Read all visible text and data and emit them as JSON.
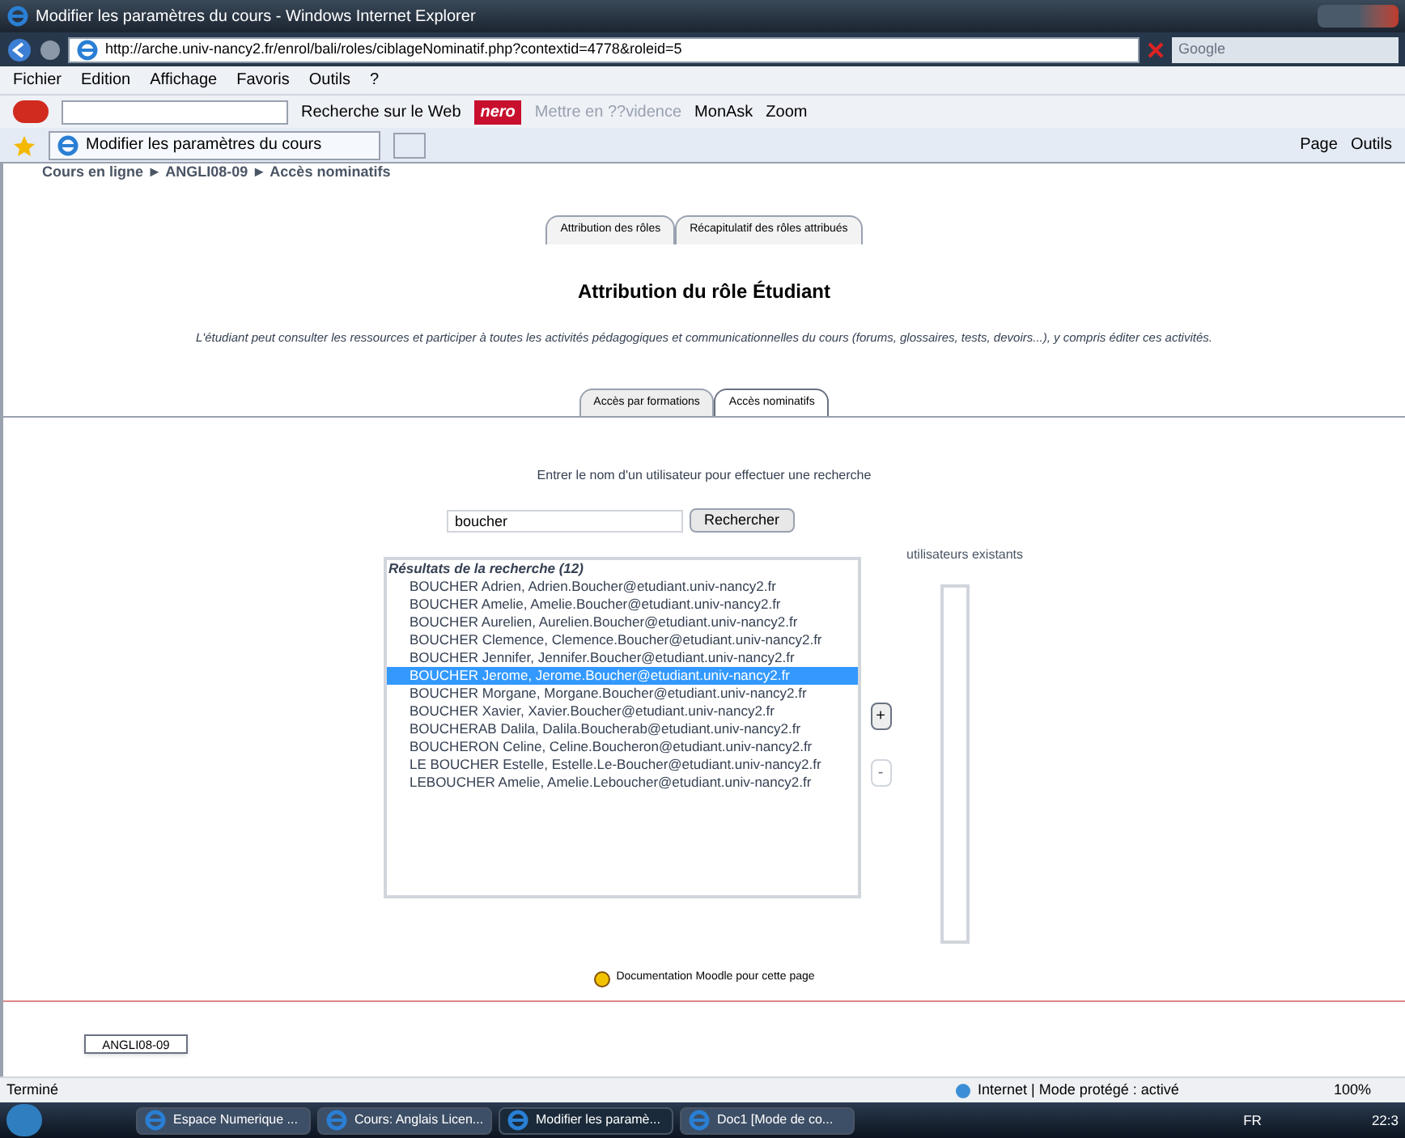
{
  "window": {
    "title": "Modifier les paramètres du cours - Windows Internet Explorer"
  },
  "address_bar": {
    "url": "http://arche.univ-nancy2.fr/enrol/bali/roles/ciblageNominatif.php?contextid=4778&roleid=5",
    "search_placeholder": "Google"
  },
  "menu": [
    "Fichier",
    "Edition",
    "Affichage",
    "Favoris",
    "Outils",
    "?"
  ],
  "toolbar": {
    "search_label": "Recherche sur le Web",
    "brand": "nero",
    "items": [
      {
        "label": "Mettre en ??vidence",
        "disabled": true
      },
      {
        "label": "MonAsk",
        "disabled": false
      },
      {
        "label": "Zoom",
        "disabled": false
      }
    ]
  },
  "browser_tab": {
    "title": "Modifier les paramètres du cours"
  },
  "command_bar": [
    "Page",
    "Outils"
  ],
  "breadcrumb": "Cours en ligne ► ANGLI08-09 ► Accès nominatifs",
  "tabs": [
    {
      "label": "Attribution des rôles",
      "selected": false
    },
    {
      "label": "Récapitulatif des rôles attribués",
      "selected": false
    }
  ],
  "heading": "Attribution du rôle Étudiant",
  "description": "L'étudiant peut consulter les ressources et participer à toutes les activités pédagogiques et communicationnelles du cours (forums, glossaires, tests, devoirs...), y compris éditer ces activités.",
  "subtabs": [
    {
      "label": "Accès par formations",
      "selected": false
    },
    {
      "label": "Accès nominatifs",
      "selected": true
    }
  ],
  "search": {
    "prompt": "Entrer le nom d'un utilisateur pour effectuer une recherche",
    "value": "boucher",
    "button": "Rechercher"
  },
  "results": {
    "header": "Résultats de la recherche (12)",
    "items": [
      {
        "label": "BOUCHER Adrien, Adrien.Boucher@etudiant.univ-nancy2.fr",
        "selected": false
      },
      {
        "label": "BOUCHER Amelie, Amelie.Boucher@etudiant.univ-nancy2.fr",
        "selected": false
      },
      {
        "label": "BOUCHER Aurelien, Aurelien.Boucher@etudiant.univ-nancy2.fr",
        "selected": false
      },
      {
        "label": "BOUCHER Clemence, Clemence.Boucher@etudiant.univ-nancy2.fr",
        "selected": false
      },
      {
        "label": "BOUCHER Jennifer, Jennifer.Boucher@etudiant.univ-nancy2.fr",
        "selected": false
      },
      {
        "label": "BOUCHER Jerome, Jerome.Boucher@etudiant.univ-nancy2.fr",
        "selected": true
      },
      {
        "label": "BOUCHER Morgane, Morgane.Boucher@etudiant.univ-nancy2.fr",
        "selected": false
      },
      {
        "label": "BOUCHER Xavier, Xavier.Boucher@etudiant.univ-nancy2.fr",
        "selected": false
      },
      {
        "label": "BOUCHERAB Dalila, Dalila.Boucherab@etudiant.univ-nancy2.fr",
        "selected": false
      },
      {
        "label": "BOUCHERON Celine, Celine.Boucheron@etudiant.univ-nancy2.fr",
        "selected": false
      },
      {
        "label": "LE BOUCHER Estelle, Estelle.Le-Boucher@etudiant.univ-nancy2.fr",
        "selected": false
      },
      {
        "label": "LEBOUCHER Amelie, Amelie.Leboucher@etudiant.univ-nancy2.fr",
        "selected": false
      }
    ]
  },
  "add_button": {
    "label": "+",
    "disabled": false
  },
  "remove_button": {
    "label": "-",
    "disabled": true
  },
  "existing": {
    "title": "utilisateurs existants"
  },
  "doc_link": "Documentation Moodle pour cette page",
  "course_button": "ANGLI08-09",
  "status_bar": {
    "status": "Terminé",
    "zone": "Internet | Mode protégé : activé",
    "zoom": "100%"
  },
  "taskbar": {
    "items": [
      {
        "label": "Espace Numerique ...",
        "selected": false
      },
      {
        "label": "Cours: Anglais Licen...",
        "selected": false
      },
      {
        "label": "Modifier les paramè...",
        "selected": true
      },
      {
        "label": "Doc1 [Mode de co...",
        "selected": false
      }
    ],
    "language": "FR",
    "clock": "22:3"
  }
}
